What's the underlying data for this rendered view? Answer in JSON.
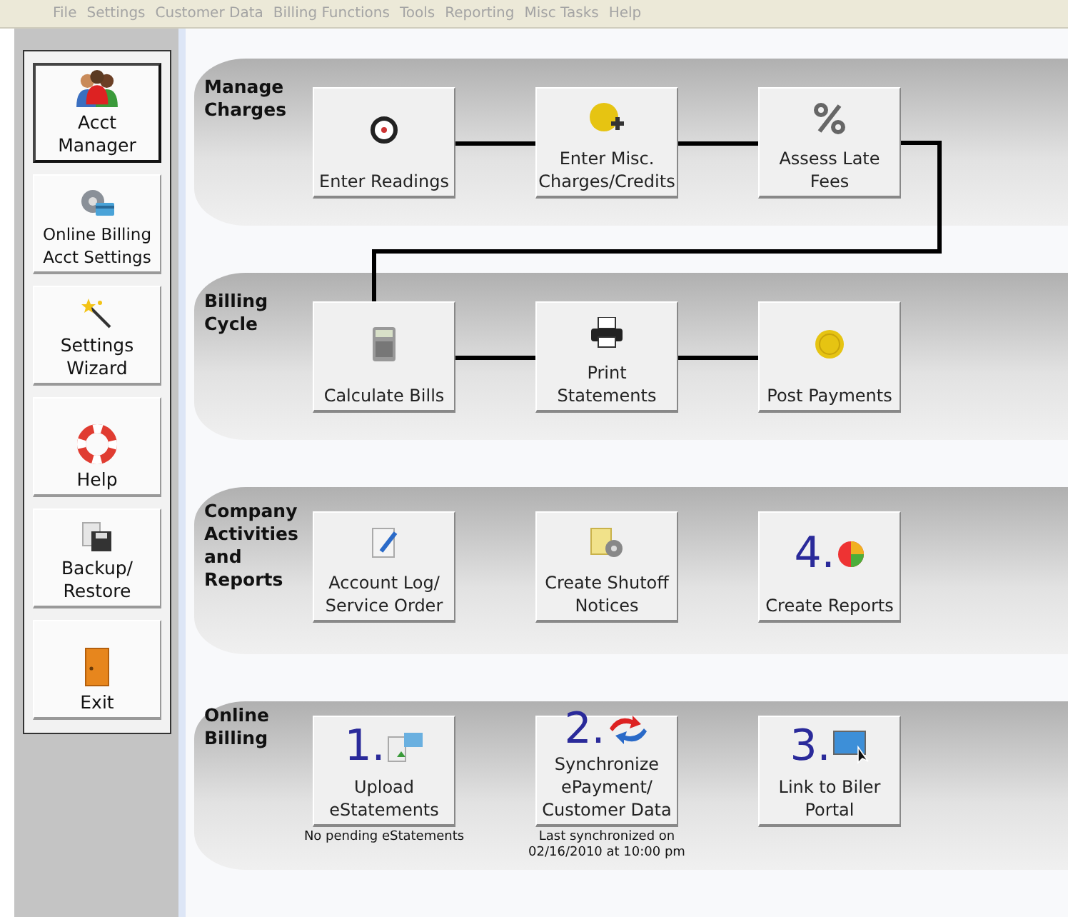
{
  "menu": [
    {
      "label": "File",
      "disabled": true
    },
    {
      "label": "Settings",
      "disabled": true
    },
    {
      "label": "Customer Data",
      "disabled": true
    },
    {
      "label": "Billing Functions",
      "disabled": true
    },
    {
      "label": "Tools",
      "disabled": true
    },
    {
      "label": "Reporting",
      "disabled": true
    },
    {
      "label": "Misc Tasks",
      "disabled": true
    },
    {
      "label": "Help",
      "disabled": true
    }
  ],
  "sidebar": [
    {
      "label": "Acct Manager",
      "selected": true
    },
    {
      "label": "Online Billing Acct Settings",
      "selected": false
    },
    {
      "label": "Settings Wizard",
      "selected": false
    },
    {
      "label": "Help",
      "selected": false
    },
    {
      "label": "Backup/ Restore",
      "selected": false
    },
    {
      "label": "Exit",
      "selected": false
    }
  ],
  "sections": [
    {
      "title": "Manage Charges",
      "connected": true,
      "tiles": [
        {
          "label": "Enter Readings"
        },
        {
          "label": "Enter Misc. Charges/Credits"
        },
        {
          "label": "Assess Late Fees"
        }
      ]
    },
    {
      "title": "Billing Cycle",
      "connected": true,
      "tiles": [
        {
          "label": "Calculate Bills"
        },
        {
          "label": "Print Statements"
        },
        {
          "label": "Post Payments"
        }
      ]
    },
    {
      "title": "Company Activities and Reports",
      "connected": false,
      "tiles": [
        {
          "label": "Account Log/ Service Order"
        },
        {
          "label": "Create Shutoff Notices"
        },
        {
          "label": "Create Reports",
          "number": "4."
        }
      ]
    },
    {
      "title": "Online Billing",
      "connected": false,
      "tiles": [
        {
          "label": "Upload eStatements",
          "number": "1.",
          "note": "No pending eStatements"
        },
        {
          "label": "Synchronize ePayment/ Customer Data",
          "number": "2.",
          "note": "Last synchronized on 02/16/2010 at 10:00 pm"
        },
        {
          "label": "Link to Biler Portal",
          "number": "3."
        }
      ]
    }
  ]
}
